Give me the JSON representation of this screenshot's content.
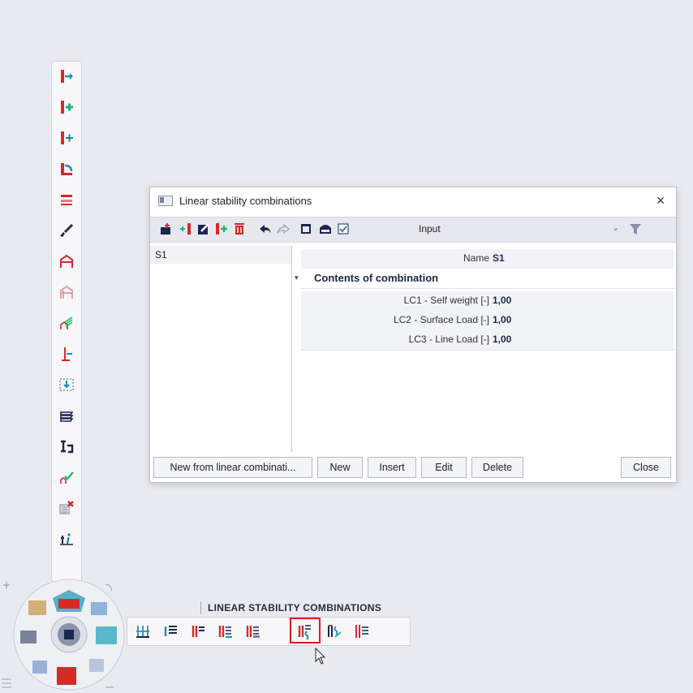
{
  "dialog": {
    "title": "Linear stability combinations",
    "close_glyph": "×",
    "toolbar": {
      "filter_label": "Input",
      "icons": [
        "new-icon",
        "new-from-icon",
        "edit-icon",
        "insert-icon",
        "delete-icon",
        "undo-icon",
        "redo-icon",
        "table-icon",
        "save-icon",
        "check-icon"
      ]
    },
    "list": {
      "items": [
        "S1"
      ]
    },
    "properties": {
      "name_label": "Name",
      "name_value": "S1",
      "section_label": "Contents of combination",
      "rows": [
        {
          "label": "LC1 - Self weight [-]",
          "value": "1,00"
        },
        {
          "label": "LC2 - Surface Load [-]",
          "value": "1,00"
        },
        {
          "label": "LC3 - Line Load [-]",
          "value": "1,00"
        }
      ]
    },
    "buttons": {
      "new_from_linear": "New from linear combinati...",
      "new": "New",
      "insert": "Insert",
      "edit": "Edit",
      "delete": "Delete",
      "close": "Close"
    }
  },
  "bottom_toolbar": {
    "title": "LINEAR STABILITY COMBINATIONS",
    "selected_index": 5
  },
  "colors": {
    "accent_red": "#d42a2a",
    "accent_blue": "#1b7fb8",
    "highlight_border": "#e01b1b"
  }
}
